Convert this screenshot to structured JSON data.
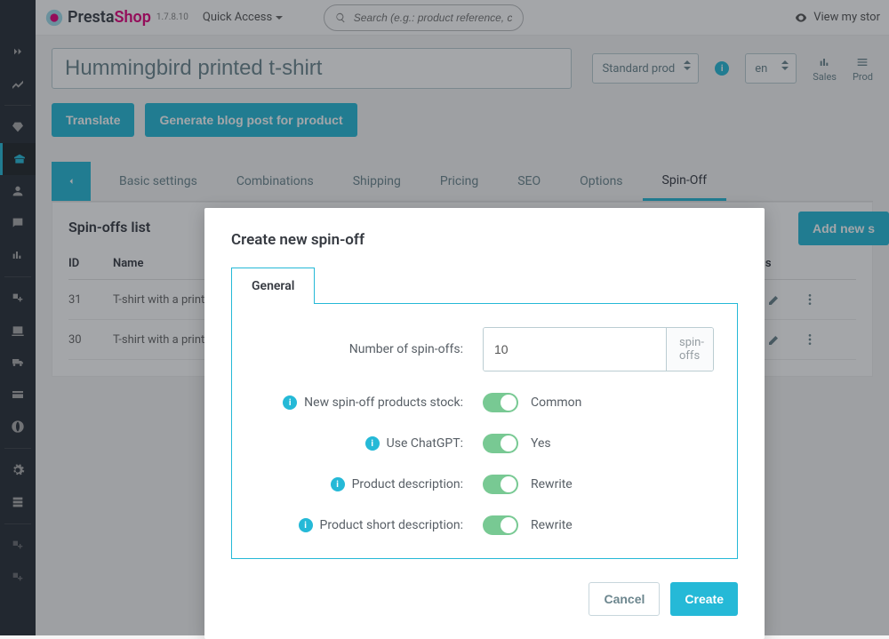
{
  "logo": {
    "p1": "Presta",
    "p2": "Shop"
  },
  "version": "1.7.8.10",
  "quick_access": "Quick Access",
  "search_placeholder": "Search (e.g.: product reference, custom",
  "view_store": "View my stor",
  "titlebar": {
    "product_name": "Hummingbird printed t-shirt",
    "type_select": "Standard prod",
    "lang": "en",
    "sales_label": "Sales",
    "prod_label": "Prod"
  },
  "actions": {
    "translate": "Translate",
    "generate": "Generate blog post for product",
    "add_new": "Add new s"
  },
  "tabs": {
    "basic": "Basic settings",
    "combinations": "Combinations",
    "shipping": "Shipping",
    "pricing": "Pricing",
    "seo": "SEO",
    "options": "Options",
    "spinoff": "Spin-Off"
  },
  "panel": {
    "title": "Spin-offs list",
    "col_id": "ID",
    "col_name": "Name",
    "col_actions": "Actions",
    "rows": [
      {
        "id": "31",
        "name": "T-shirt with a print o"
      },
      {
        "id": "30",
        "name": "T-shirt with a print o"
      }
    ]
  },
  "modal": {
    "title": "Create new spin-off",
    "tab": "General",
    "labels": {
      "number": "Number of spin-offs:",
      "stock": "New spin-off products stock:",
      "chatgpt": "Use ChatGPT:",
      "desc": "Product description:",
      "shortdesc": "Product short description:"
    },
    "value_number": "10",
    "suffix": "spin-offs",
    "val_stock": "Common",
    "val_chatgpt": "Yes",
    "val_desc": "Rewrite",
    "val_shortdesc": "Rewrite",
    "cancel": "Cancel",
    "create": "Create"
  }
}
